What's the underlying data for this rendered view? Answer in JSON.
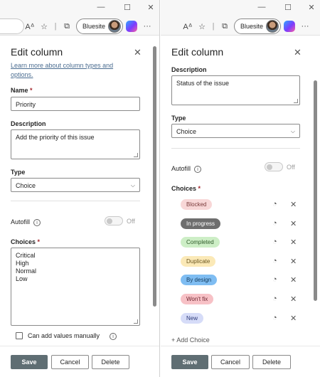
{
  "browser": {
    "profile_name": "Bluesite",
    "more_label": "···"
  },
  "left_panel": {
    "title": "Edit column",
    "learn_more_line1": "Learn more about column types and",
    "learn_more_line2": "options.",
    "name_label": "Name",
    "required_mark": "*",
    "name_value": "Priority",
    "description_label": "Description",
    "description_value": "Add the priority of this issue",
    "type_label": "Type",
    "type_value": "Choice",
    "autofill_label": "Autofill",
    "autofill_state": "Off",
    "choices_label": "Choices",
    "choices_text": [
      "Critical",
      "High",
      "Normal",
      "Low"
    ],
    "can_add_values_label": "Can add values manually"
  },
  "right_panel": {
    "title": "Edit column",
    "description_label": "Description",
    "description_value": "Status of the issue",
    "type_label": "Type",
    "type_value": "Choice",
    "autofill_label": "Autofill",
    "autofill_state": "Off",
    "choices_label": "Choices",
    "choices": [
      {
        "label": "Blocked",
        "bg": "#f8d7d7",
        "fg": "#7a3b3b"
      },
      {
        "label": "In progress",
        "bg": "#6e6e6e",
        "fg": "#ffffff"
      },
      {
        "label": "Completed",
        "bg": "#cdeec6",
        "fg": "#2f5a2a"
      },
      {
        "label": "Duplicate",
        "bg": "#fbe9b7",
        "fg": "#6a5520"
      },
      {
        "label": "By design",
        "bg": "#7fbdf2",
        "fg": "#123a5c"
      },
      {
        "label": "Won't fix",
        "bg": "#f7c1c6",
        "fg": "#6e2530"
      },
      {
        "label": "New",
        "bg": "#d6dcf8",
        "fg": "#2d3a78"
      }
    ],
    "add_choice_label": "Add Choice"
  },
  "footer": {
    "save_label": "Save",
    "cancel_label": "Cancel",
    "delete_label": "Delete"
  },
  "colors": {
    "primary_button": "#5f6e73",
    "link": "#4b6d91",
    "required": "#a4262c"
  }
}
